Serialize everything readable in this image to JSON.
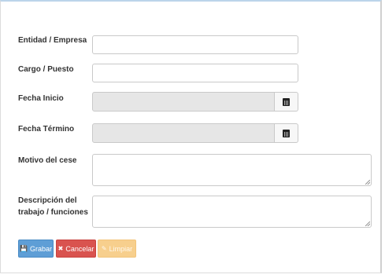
{
  "form": {
    "fields": {
      "entidad": {
        "label": "Entidad / Empresa",
        "value": ""
      },
      "cargo": {
        "label": "Cargo / Puesto",
        "value": ""
      },
      "fecha_inicio": {
        "label": "Fecha Inicio",
        "value": ""
      },
      "fecha_termino": {
        "label": "Fecha Término",
        "value": ""
      },
      "motivo": {
        "label": "Motivo del cese",
        "value": ""
      },
      "descripcion": {
        "label_line1": "Descripción del",
        "label_line2": "trabajo / funciones",
        "value": ""
      }
    },
    "buttons": {
      "grabar": {
        "label": "Grabar",
        "icon": "save-icon",
        "color": "#5e9ed6"
      },
      "cancelar": {
        "label": "Cancelar",
        "icon": "close-icon",
        "color": "#d9534f"
      },
      "limpiar": {
        "label": "Limpiar",
        "icon": "eraser-icon",
        "color": "#f7cf8d"
      }
    }
  }
}
